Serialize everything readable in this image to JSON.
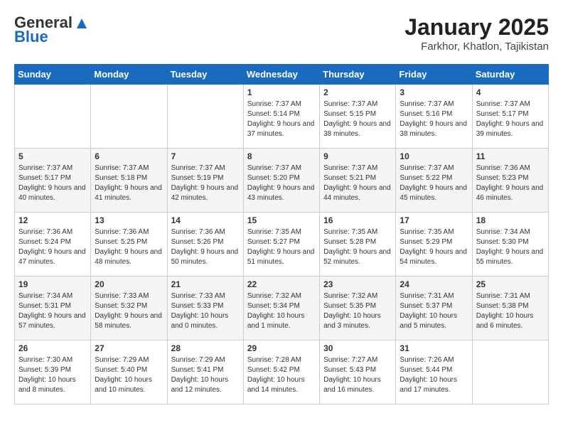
{
  "header": {
    "logo_line1": "General",
    "logo_line2": "Blue",
    "month": "January 2025",
    "location": "Farkhor, Khatlon, Tajikistan"
  },
  "days_of_week": [
    "Sunday",
    "Monday",
    "Tuesday",
    "Wednesday",
    "Thursday",
    "Friday",
    "Saturday"
  ],
  "weeks": [
    {
      "days": [
        {
          "number": "",
          "info": ""
        },
        {
          "number": "",
          "info": ""
        },
        {
          "number": "",
          "info": ""
        },
        {
          "number": "1",
          "info": "Sunrise: 7:37 AM\nSunset: 5:14 PM\nDaylight: 9 hours and 37 minutes."
        },
        {
          "number": "2",
          "info": "Sunrise: 7:37 AM\nSunset: 5:15 PM\nDaylight: 9 hours and 38 minutes."
        },
        {
          "number": "3",
          "info": "Sunrise: 7:37 AM\nSunset: 5:16 PM\nDaylight: 9 hours and 38 minutes."
        },
        {
          "number": "4",
          "info": "Sunrise: 7:37 AM\nSunset: 5:17 PM\nDaylight: 9 hours and 39 minutes."
        }
      ]
    },
    {
      "days": [
        {
          "number": "5",
          "info": "Sunrise: 7:37 AM\nSunset: 5:17 PM\nDaylight: 9 hours and 40 minutes."
        },
        {
          "number": "6",
          "info": "Sunrise: 7:37 AM\nSunset: 5:18 PM\nDaylight: 9 hours and 41 minutes."
        },
        {
          "number": "7",
          "info": "Sunrise: 7:37 AM\nSunset: 5:19 PM\nDaylight: 9 hours and 42 minutes."
        },
        {
          "number": "8",
          "info": "Sunrise: 7:37 AM\nSunset: 5:20 PM\nDaylight: 9 hours and 43 minutes."
        },
        {
          "number": "9",
          "info": "Sunrise: 7:37 AM\nSunset: 5:21 PM\nDaylight: 9 hours and 44 minutes."
        },
        {
          "number": "10",
          "info": "Sunrise: 7:37 AM\nSunset: 5:22 PM\nDaylight: 9 hours and 45 minutes."
        },
        {
          "number": "11",
          "info": "Sunrise: 7:36 AM\nSunset: 5:23 PM\nDaylight: 9 hours and 46 minutes."
        }
      ]
    },
    {
      "days": [
        {
          "number": "12",
          "info": "Sunrise: 7:36 AM\nSunset: 5:24 PM\nDaylight: 9 hours and 47 minutes."
        },
        {
          "number": "13",
          "info": "Sunrise: 7:36 AM\nSunset: 5:25 PM\nDaylight: 9 hours and 48 minutes."
        },
        {
          "number": "14",
          "info": "Sunrise: 7:36 AM\nSunset: 5:26 PM\nDaylight: 9 hours and 50 minutes."
        },
        {
          "number": "15",
          "info": "Sunrise: 7:35 AM\nSunset: 5:27 PM\nDaylight: 9 hours and 51 minutes."
        },
        {
          "number": "16",
          "info": "Sunrise: 7:35 AM\nSunset: 5:28 PM\nDaylight: 9 hours and 52 minutes."
        },
        {
          "number": "17",
          "info": "Sunrise: 7:35 AM\nSunset: 5:29 PM\nDaylight: 9 hours and 54 minutes."
        },
        {
          "number": "18",
          "info": "Sunrise: 7:34 AM\nSunset: 5:30 PM\nDaylight: 9 hours and 55 minutes."
        }
      ]
    },
    {
      "days": [
        {
          "number": "19",
          "info": "Sunrise: 7:34 AM\nSunset: 5:31 PM\nDaylight: 9 hours and 57 minutes."
        },
        {
          "number": "20",
          "info": "Sunrise: 7:33 AM\nSunset: 5:32 PM\nDaylight: 9 hours and 58 minutes."
        },
        {
          "number": "21",
          "info": "Sunrise: 7:33 AM\nSunset: 5:33 PM\nDaylight: 10 hours and 0 minutes."
        },
        {
          "number": "22",
          "info": "Sunrise: 7:32 AM\nSunset: 5:34 PM\nDaylight: 10 hours and 1 minute."
        },
        {
          "number": "23",
          "info": "Sunrise: 7:32 AM\nSunset: 5:35 PM\nDaylight: 10 hours and 3 minutes."
        },
        {
          "number": "24",
          "info": "Sunrise: 7:31 AM\nSunset: 5:37 PM\nDaylight: 10 hours and 5 minutes."
        },
        {
          "number": "25",
          "info": "Sunrise: 7:31 AM\nSunset: 5:38 PM\nDaylight: 10 hours and 6 minutes."
        }
      ]
    },
    {
      "days": [
        {
          "number": "26",
          "info": "Sunrise: 7:30 AM\nSunset: 5:39 PM\nDaylight: 10 hours and 8 minutes."
        },
        {
          "number": "27",
          "info": "Sunrise: 7:29 AM\nSunset: 5:40 PM\nDaylight: 10 hours and 10 minutes."
        },
        {
          "number": "28",
          "info": "Sunrise: 7:29 AM\nSunset: 5:41 PM\nDaylight: 10 hours and 12 minutes."
        },
        {
          "number": "29",
          "info": "Sunrise: 7:28 AM\nSunset: 5:42 PM\nDaylight: 10 hours and 14 minutes."
        },
        {
          "number": "30",
          "info": "Sunrise: 7:27 AM\nSunset: 5:43 PM\nDaylight: 10 hours and 16 minutes."
        },
        {
          "number": "31",
          "info": "Sunrise: 7:26 AM\nSunset: 5:44 PM\nDaylight: 10 hours and 17 minutes."
        },
        {
          "number": "",
          "info": ""
        }
      ]
    }
  ]
}
